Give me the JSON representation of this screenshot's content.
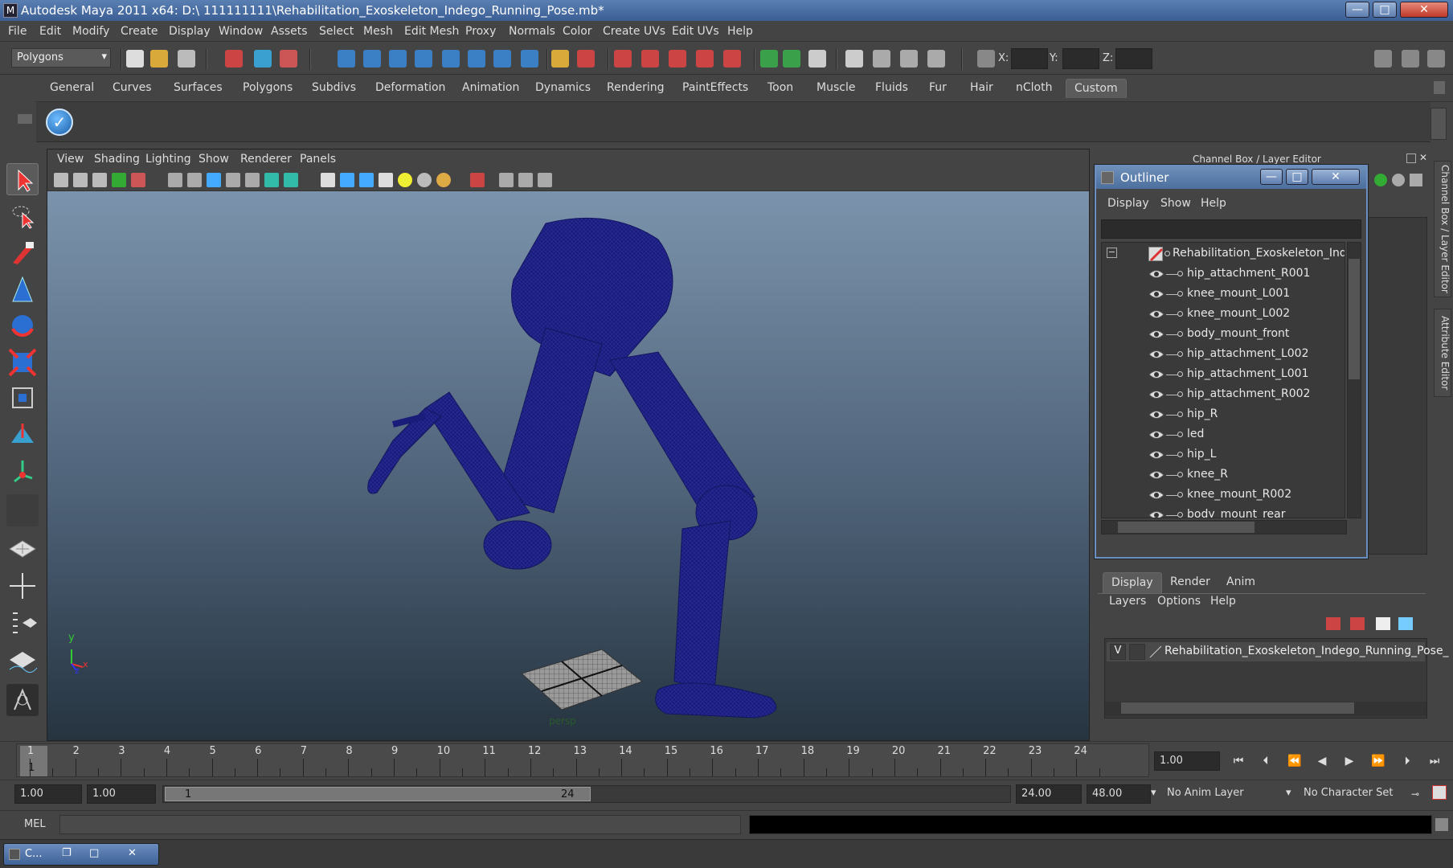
{
  "window": {
    "title": "Autodesk Maya 2011 x64: D:\\ 111111111\\Rehabilitation_Exoskeleton_Indego_Running_Pose.mb*",
    "app_icon": "maya-icon",
    "minimize": "—",
    "maximize": "□",
    "close": "✕"
  },
  "menubar": [
    "File",
    "Edit",
    "Modify",
    "Create",
    "Display",
    "Window",
    "Assets",
    "Select",
    "Mesh",
    "Edit Mesh",
    "Proxy",
    "Normals",
    "Color",
    "Create UVs",
    "Edit UVs",
    "Help"
  ],
  "toolbar": {
    "mode_select": "Polygons",
    "coord_x_label": "X:",
    "coord_y_label": "Y:",
    "coord_z_label": "Z:"
  },
  "shelf": {
    "tabs": [
      "General",
      "Curves",
      "Surfaces",
      "Polygons",
      "Subdivs",
      "Deformation",
      "Animation",
      "Dynamics",
      "Rendering",
      "PaintEffects",
      "Toon",
      "Muscle",
      "Fluids",
      "Fur",
      "Hair",
      "nCloth",
      "Custom"
    ],
    "active_tab": "Custom"
  },
  "viewport": {
    "menu": [
      "View",
      "Shading",
      "Lighting",
      "Show",
      "Renderer",
      "Panels"
    ],
    "camera_label": "persp",
    "axis_y": "y",
    "axis_x": "x",
    "axis_z": "z"
  },
  "channel_box": {
    "title": "Channel Box / Layer Editor",
    "side_tabs": [
      "Channel Box / Layer Editor",
      "Attribute Editor"
    ]
  },
  "outliner": {
    "title": "Outliner",
    "minimize": "—",
    "maximize": "□",
    "close": "✕",
    "menu": [
      "Display",
      "Show",
      "Help"
    ],
    "root": "Rehabilitation_Exoskeleton_Indego_Running_Pose",
    "items": [
      "hip_attachment_R001",
      "knee_mount_L001",
      "knee_mount_L002",
      "body_mount_front",
      "hip_attachment_L002",
      "hip_attachment_L001",
      "hip_attachment_R002",
      "hip_R",
      "led",
      "hip_L",
      "knee_R",
      "knee_mount_R002",
      "body_mount_rear"
    ]
  },
  "layer_editor": {
    "tabs": [
      "Display",
      "Render",
      "Anim"
    ],
    "active_tab": "Display",
    "menu": [
      "Layers",
      "Options",
      "Help"
    ],
    "layer_visible": "V",
    "layer_name": "Rehabilitation_Exoskeleton_Indego_Running_Pose_"
  },
  "timeline": {
    "frames": [
      "1",
      "2",
      "3",
      "4",
      "5",
      "6",
      "7",
      "8",
      "9",
      "10",
      "11",
      "12",
      "13",
      "14",
      "15",
      "16",
      "17",
      "18",
      "19",
      "20",
      "21",
      "22",
      "23",
      "24"
    ],
    "current_frame": "1",
    "current_time": "1.00"
  },
  "range": {
    "start": "1.00",
    "playback_start": "1.00",
    "slider_start": "1",
    "slider_end": "24",
    "playback_end": "24.00",
    "end": "48.00",
    "anim_layer": "No Anim Layer",
    "character_set": "No Character Set"
  },
  "command": {
    "label": "MEL"
  },
  "taskbar": {
    "item": "C..."
  }
}
